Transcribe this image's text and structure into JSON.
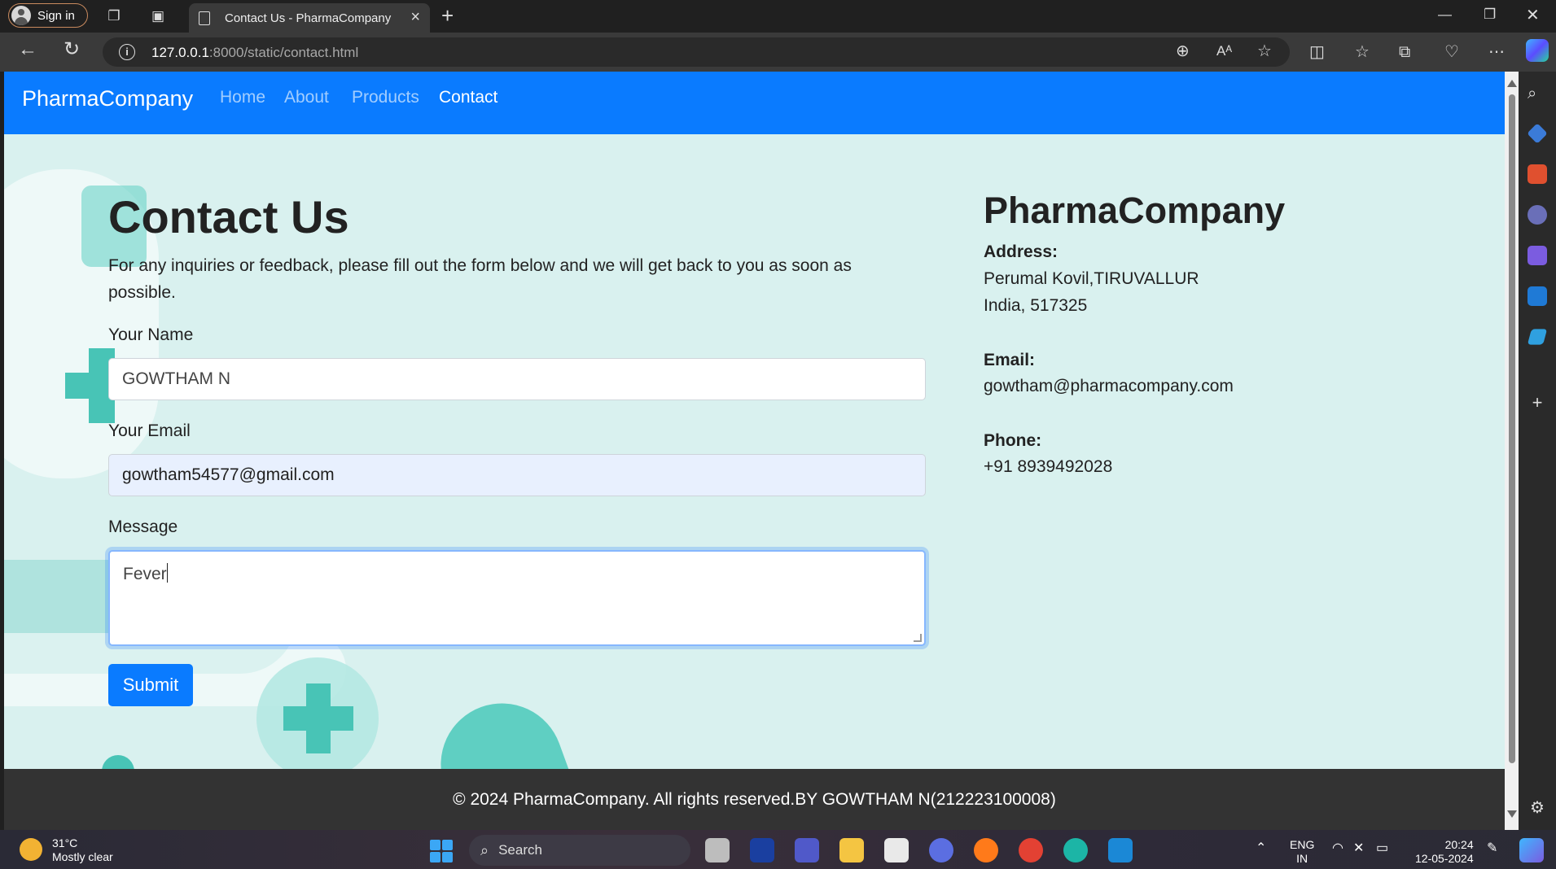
{
  "browser": {
    "signin_label": "Sign in",
    "tab_title": "Contact Us - PharmaCompany",
    "url_host": "127.0.0.1",
    "url_path": ":8000/static/contact.html"
  },
  "navbar": {
    "brand": "PharmaCompany",
    "links": [
      "Home",
      "About",
      "Products",
      "Contact"
    ],
    "active": "Contact",
    "bg_color": "#0a7bff"
  },
  "form": {
    "heading": "Contact Us",
    "intro": "For any inquiries or feedback, please fill out the form below and we will get back to you as soon as possible.",
    "name_label": "Your Name",
    "name_value": "GOWTHAM N",
    "email_label": "Your Email",
    "email_value": "gowtham54577@gmail.com",
    "message_label": "Message",
    "message_value": "Fever",
    "submit_label": "Submit"
  },
  "company": {
    "title": "PharmaCompany",
    "address_label": "Address:",
    "address_line1": "Perumal Kovil,TIRUVALLUR",
    "address_line2": "India, 517325",
    "email_label": "Email:",
    "email_value": "gowtham@pharmacompany.com",
    "phone_label": "Phone:",
    "phone_value": "+91 8939492028"
  },
  "footer": {
    "text": "© 2024 PharmaCompany. All rights reserved.BY GOWTHAM N(212223100008)"
  },
  "taskbar": {
    "temperature": "31°C",
    "weather": "Mostly clear",
    "search_label": "Search",
    "lang_line1": "ENG",
    "lang_line2": "IN",
    "time": "20:24",
    "date": "12-05-2024"
  }
}
